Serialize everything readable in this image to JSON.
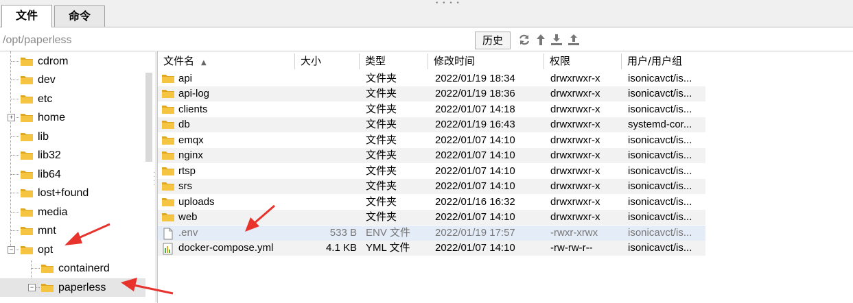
{
  "tabs": [
    {
      "label": "文件",
      "active": true
    },
    {
      "label": "命令",
      "active": false
    }
  ],
  "pathbar": {
    "path": "/opt/paperless",
    "history_label": "历史",
    "tool_icons": [
      "refresh-icon",
      "up-arrow-icon",
      "download-icon",
      "upload-icon"
    ]
  },
  "tree": {
    "items": [
      {
        "label": "cdrom",
        "expander": ""
      },
      {
        "label": "dev",
        "expander": ""
      },
      {
        "label": "etc",
        "expander": ""
      },
      {
        "label": "home",
        "expander": "+"
      },
      {
        "label": "lib",
        "expander": "",
        "link": true
      },
      {
        "label": "lib32",
        "expander": "",
        "link": true
      },
      {
        "label": "lib64",
        "expander": "",
        "link": true
      },
      {
        "label": "lost+found",
        "expander": ""
      },
      {
        "label": "media",
        "expander": ""
      },
      {
        "label": "mnt",
        "expander": ""
      },
      {
        "label": "opt",
        "expander": "−"
      },
      {
        "label": "containerd",
        "expander": "",
        "child": true
      },
      {
        "label": "paperless",
        "expander": "−",
        "child": true,
        "selected": true
      }
    ]
  },
  "columns": [
    "文件名",
    "大小",
    "类型",
    "修改时间",
    "权限",
    "用户/用户组"
  ],
  "files": [
    {
      "name": "api",
      "size": "",
      "type": "文件夹",
      "mtime": "2022/01/19 18:34",
      "perm": "drwxrwxr-x",
      "owner": "isonicavct/is...",
      "kind": "folder"
    },
    {
      "name": "api-log",
      "size": "",
      "type": "文件夹",
      "mtime": "2022/01/19 18:36",
      "perm": "drwxrwxr-x",
      "owner": "isonicavct/is...",
      "kind": "folder"
    },
    {
      "name": "clients",
      "size": "",
      "type": "文件夹",
      "mtime": "2022/01/07 14:18",
      "perm": "drwxrwxr-x",
      "owner": "isonicavct/is...",
      "kind": "folder"
    },
    {
      "name": "db",
      "size": "",
      "type": "文件夹",
      "mtime": "2022/01/19 16:43",
      "perm": "drwxrwxr-x",
      "owner": "systemd-cor...",
      "kind": "folder"
    },
    {
      "name": "emqx",
      "size": "",
      "type": "文件夹",
      "mtime": "2022/01/07 14:10",
      "perm": "drwxrwxr-x",
      "owner": "isonicavct/is...",
      "kind": "folder"
    },
    {
      "name": "nginx",
      "size": "",
      "type": "文件夹",
      "mtime": "2022/01/07 14:10",
      "perm": "drwxrwxr-x",
      "owner": "isonicavct/is...",
      "kind": "folder"
    },
    {
      "name": "rtsp",
      "size": "",
      "type": "文件夹",
      "mtime": "2022/01/07 14:10",
      "perm": "drwxrwxr-x",
      "owner": "isonicavct/is...",
      "kind": "folder"
    },
    {
      "name": "srs",
      "size": "",
      "type": "文件夹",
      "mtime": "2022/01/07 14:10",
      "perm": "drwxrwxr-x",
      "owner": "isonicavct/is...",
      "kind": "folder"
    },
    {
      "name": "uploads",
      "size": "",
      "type": "文件夹",
      "mtime": "2022/01/16 16:32",
      "perm": "drwxrwxr-x",
      "owner": "isonicavct/is...",
      "kind": "folder"
    },
    {
      "name": "web",
      "size": "",
      "type": "文件夹",
      "mtime": "2022/01/07 14:10",
      "perm": "drwxrwxr-x",
      "owner": "isonicavct/is...",
      "kind": "folder"
    },
    {
      "name": ".env",
      "size": "533 B",
      "type": "ENV 文件",
      "mtime": "2022/01/19 17:57",
      "perm": "-rwxr-xrwx",
      "owner": "isonicavct/is...",
      "kind": "file",
      "selected": true
    },
    {
      "name": "docker-compose.yml",
      "size": "4.1 KB",
      "type": "YML 文件",
      "mtime": "2022/01/07 14:10",
      "perm": "-rw-rw-r--",
      "owner": "isonicavct/is...",
      "kind": "yml"
    }
  ],
  "colors": {
    "folder": "#f5c542",
    "folder_dark": "#e0a820",
    "annotation_arrow": "#e8322c",
    "selection": "#e4ecf7"
  }
}
